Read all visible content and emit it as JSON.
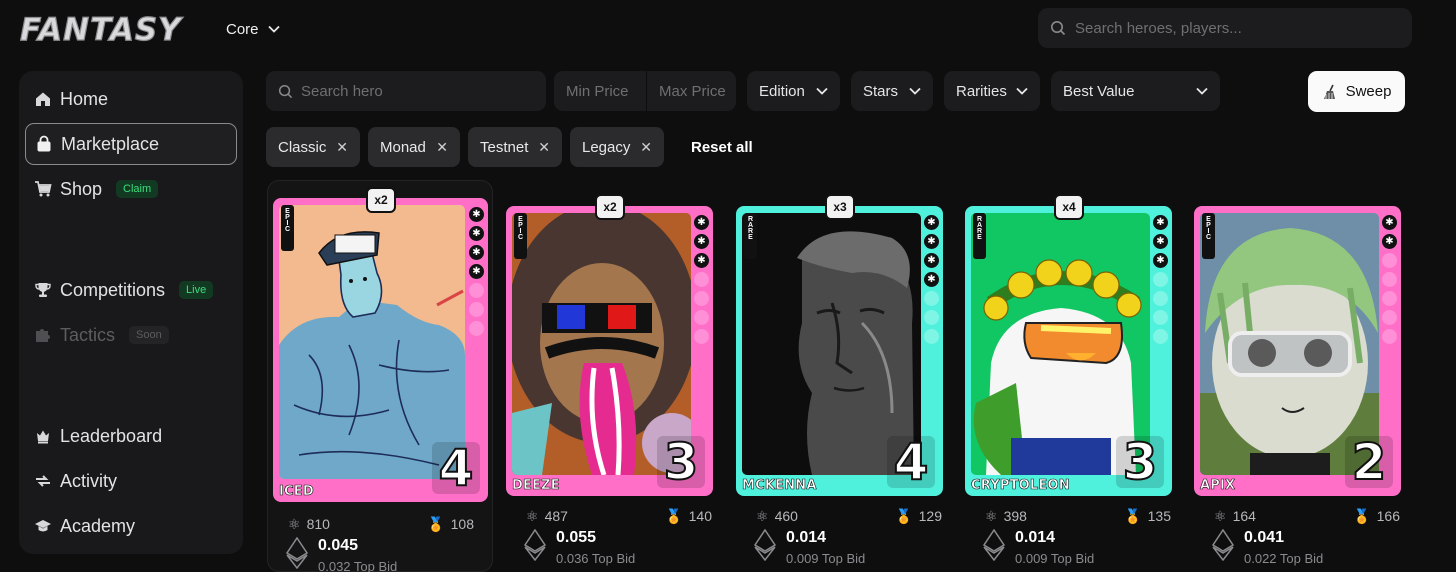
{
  "brand": {
    "logo_text": "FANTASY"
  },
  "header": {
    "network_select": "Core",
    "search_placeholder": "Search heroes, players..."
  },
  "sidebar": {
    "items": [
      {
        "label": "Home",
        "icon": "home-icon"
      },
      {
        "label": "Marketplace",
        "icon": "bag-icon",
        "active": true
      },
      {
        "label": "Shop",
        "icon": "cart-icon",
        "badge": "Claim"
      },
      {
        "label": "Competitions",
        "icon": "trophy-icon",
        "badge": "Live"
      },
      {
        "label": "Tactics",
        "icon": "puzzle-icon",
        "badge": "Soon",
        "disabled": true
      },
      {
        "label": "Leaderboard",
        "icon": "crown-icon"
      },
      {
        "label": "Activity",
        "icon": "activity-icon"
      },
      {
        "label": "Academy",
        "icon": "graduation-cap-icon"
      }
    ]
  },
  "filters": {
    "search_placeholder": "Search hero",
    "min_price_placeholder": "Min Price",
    "max_price_placeholder": "Max Price",
    "dropdowns": [
      "Edition",
      "Stars",
      "Rarities",
      "Best Value"
    ],
    "sweep_label": "Sweep",
    "chips": [
      "Classic",
      "Monad",
      "Testnet",
      "Legacy"
    ],
    "reset_label": "Reset all"
  },
  "cards": [
    {
      "name": "ICED",
      "rarity": "EPIC",
      "multiplier": "x2",
      "number": "4",
      "stars": 4,
      "frame_color": "#ff6fc8",
      "stat_a": "810",
      "stat_b": "108",
      "price": "0.045",
      "top_bid": "0.032 Top Bid"
    },
    {
      "name": "DEEZE",
      "rarity": "EPIC",
      "multiplier": "x2",
      "number": "3",
      "stars": 3,
      "frame_color": "#ff6fc8",
      "stat_a": "487",
      "stat_b": "140",
      "price": "0.055",
      "top_bid": "0.036 Top Bid"
    },
    {
      "name": "MCKENNA",
      "rarity": "RARE",
      "multiplier": "x3",
      "number": "4",
      "stars": 4,
      "frame_color": "#4ff0dc",
      "stat_a": "460",
      "stat_b": "129",
      "price": "0.014",
      "top_bid": "0.009 Top Bid"
    },
    {
      "name": "CRYPTOLEON",
      "rarity": "RARE",
      "multiplier": "x4",
      "number": "3",
      "stars": 3,
      "frame_color": "#4ff0dc",
      "stat_a": "398",
      "stat_b": "135",
      "price": "0.014",
      "top_bid": "0.009 Top Bid"
    },
    {
      "name": "APIX",
      "rarity": "EPIC",
      "multiplier": "",
      "number": "2",
      "stars": 2,
      "frame_color": "#ff6fc8",
      "stat_a": "164",
      "stat_b": "166",
      "price": "0.041",
      "top_bid": "0.022 Top Bid"
    }
  ],
  "colors": {
    "background": "#0e0e0f",
    "panel": "#19191b",
    "epic": "#ff6fc8",
    "rare": "#4ff0dc",
    "live_green": "#3edc7c"
  }
}
